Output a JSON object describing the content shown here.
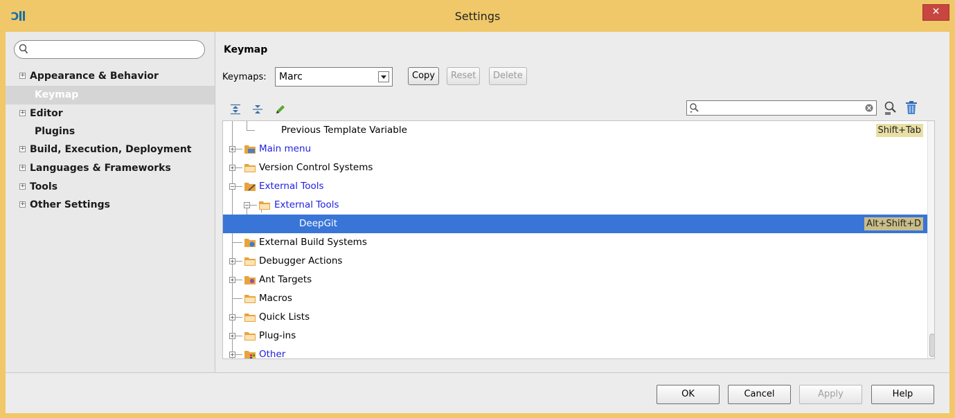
{
  "window": {
    "title": "Settings",
    "close_glyph": "✕",
    "accent": "#f0c869"
  },
  "sidebar": {
    "search_placeholder": "",
    "items": [
      {
        "label": "Appearance & Behavior",
        "expandable": true
      },
      {
        "label": "Keymap",
        "expandable": false,
        "selected": true
      },
      {
        "label": "Editor",
        "expandable": true
      },
      {
        "label": "Plugins",
        "expandable": false
      },
      {
        "label": "Build, Execution, Deployment",
        "expandable": true
      },
      {
        "label": "Languages & Frameworks",
        "expandable": true
      },
      {
        "label": "Tools",
        "expandable": true
      },
      {
        "label": "Other Settings",
        "expandable": true
      }
    ]
  },
  "keymap": {
    "section_title": "Keymap",
    "keymaps_label": "Keymaps:",
    "selected_keymap": "Marc",
    "copy_label": "Copy",
    "reset_label": "Reset",
    "delete_label": "Delete",
    "filter_value": "",
    "tree": [
      {
        "label": "Previous Template Variable",
        "shortcut": "Shift+Tab",
        "blue": false
      },
      {
        "label": "Main menu",
        "shortcut": "",
        "blue": true
      },
      {
        "label": "Version Control Systems",
        "shortcut": "",
        "blue": false
      },
      {
        "label": "External Tools",
        "shortcut": "",
        "blue": true
      },
      {
        "label": "External Tools",
        "shortcut": "",
        "blue": true
      },
      {
        "label": "DeepGit",
        "shortcut": "Alt+Shift+D",
        "blue": false,
        "selected": true
      },
      {
        "label": "External Build Systems",
        "shortcut": "",
        "blue": false
      },
      {
        "label": "Debugger Actions",
        "shortcut": "",
        "blue": false
      },
      {
        "label": "Ant Targets",
        "shortcut": "",
        "blue": false
      },
      {
        "label": "Macros",
        "shortcut": "",
        "blue": false
      },
      {
        "label": "Quick Lists",
        "shortcut": "",
        "blue": false
      },
      {
        "label": "Plug-ins",
        "shortcut": "",
        "blue": false
      },
      {
        "label": "Other",
        "shortcut": "",
        "blue": true
      }
    ]
  },
  "footer": {
    "ok_label": "OK",
    "cancel_label": "Cancel",
    "apply_label": "Apply",
    "help_label": "Help"
  }
}
